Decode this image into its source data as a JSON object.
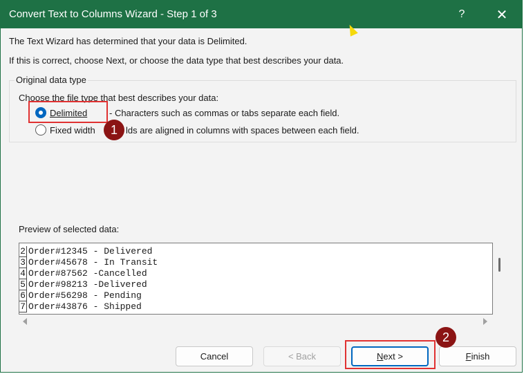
{
  "window": {
    "title": "Convert Text to Columns Wizard - Step 1 of 3",
    "help_label": "?",
    "close_label": "✕"
  },
  "intro": {
    "line1": "The Text Wizard has determined that your data is Delimited.",
    "line2": "If this is correct, choose Next, or choose the data type that best describes your data."
  },
  "original_data_type": {
    "legend": "Original data type",
    "prompt": "Choose the file type that best describes your data:",
    "options": [
      {
        "label": "Delimited",
        "description": "- Characters such as commas or tabs separate each field.",
        "selected": true
      },
      {
        "label": "Fixed width",
        "description": "lds are aligned in columns with spaces between each field.",
        "selected": false
      }
    ]
  },
  "preview": {
    "label": "Preview of selected data:",
    "rows": [
      {
        "num": "2",
        "text": "Order#12345 - Delivered"
      },
      {
        "num": "3",
        "text": "Order#45678 - In Transit"
      },
      {
        "num": "4",
        "text": "Order#87562 -Cancelled"
      },
      {
        "num": "5",
        "text": "Order#98213 -Delivered"
      },
      {
        "num": "6",
        "text": "Order#56298 - Pending"
      },
      {
        "num": "7",
        "text": "Order#43876 - Shipped"
      }
    ]
  },
  "buttons": {
    "cancel": "Cancel",
    "back": "< Back",
    "next_key": "N",
    "next_rest": "ext >",
    "finish_key": "F",
    "finish_rest": "inish"
  },
  "markers": {
    "first": "1",
    "second": "2"
  },
  "colors": {
    "title_bar": "#1e7145",
    "accent": "#0067c0",
    "highlight": "#e03131",
    "marker": "#8b1414"
  },
  "icons": {
    "cursor": "mouse-pointer-icon"
  }
}
